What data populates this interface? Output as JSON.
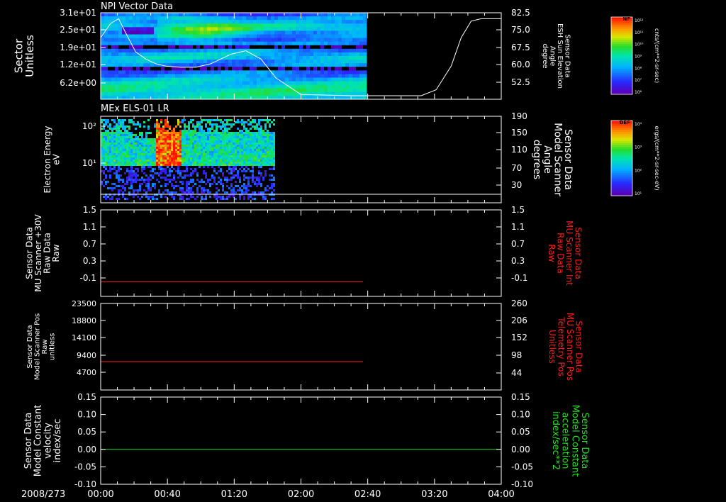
{
  "date_label": "2008/273",
  "time_ticks": [
    "00:00",
    "00:40",
    "01:20",
    "02:00",
    "02:40",
    "03:20",
    "04:00"
  ],
  "colors": {
    "axis": "#ffffff",
    "red_trace": "#ff2020",
    "green_trace": "#20e020",
    "red_label": "#ff1a1a",
    "green_label": "#22dd22",
    "background": "#000000"
  },
  "colorbars": [
    {
      "name": "NF",
      "units": "cnts/(cm**2-sr-sec)",
      "ticks": [
        "10¹²",
        "10¹¹",
        "10¹⁰",
        "10⁹",
        "10⁸",
        "10⁷",
        "10⁶"
      ]
    },
    {
      "name": "DEF",
      "units": "ergs/(cm**2-sr-sec-eV)",
      "ticks": [
        "10⁴",
        "10³",
        "10²",
        "10¹"
      ]
    }
  ],
  "chart_data": [
    {
      "type": "heatmap",
      "title": "NPI Vector Data",
      "ylabel": [
        "Sector",
        "Unitless"
      ],
      "yticks": [
        "3.1e+01",
        "2.5e+01",
        "1.9e+01",
        "1.2e+01",
        "6.2e+00"
      ],
      "y2label": [
        "Sensor Data",
        "ESH Sun Elevation",
        "Angle",
        "degree"
      ],
      "y2ticks": [
        "82.5",
        "75.0",
        "67.5",
        "60.0",
        "52.5"
      ],
      "y2lim": [
        46,
        82.5
      ],
      "data_end_hours": 2.62,
      "overlay_line": {
        "name": "ESH Sun Elevation Angle",
        "x": [
          0,
          0.1,
          0.18,
          0.25,
          0.35,
          0.45,
          0.55,
          0.65,
          0.8,
          0.95,
          1.1,
          1.2,
          1.3,
          1.45,
          1.6,
          1.75,
          2.0,
          2.5,
          3.0,
          3.2,
          3.35,
          3.5,
          3.6,
          3.7,
          3.8,
          4.0
        ],
        "y": [
          72,
          78,
          80,
          74,
          66,
          63,
          61,
          60,
          59.5,
          59.5,
          61,
          63,
          65,
          66.5,
          63,
          55,
          48,
          47.5,
          47.5,
          47.5,
          50,
          60,
          72,
          79,
          80,
          80
        ]
      }
    },
    {
      "type": "heatmap",
      "title": "MEx ELS-01 LR",
      "ylabel": [
        "Electron Energy",
        "eV"
      ],
      "yticks": [
        "10²",
        "10¹"
      ],
      "y2label": [
        "Sensor Data",
        "Model Scanner",
        "Angle",
        "degrees"
      ],
      "y2ticks": [
        "190",
        "150",
        "110",
        "70",
        "30"
      ],
      "data_end_hours": 1.73,
      "overlay_line": {
        "name": "Model Scanner Angle",
        "x": [
          0,
          4
        ],
        "y": [
          10,
          10
        ]
      }
    },
    {
      "type": "line",
      "ylabel": [
        "Sensor Data",
        "MU Scanner +30V",
        "Raw Data",
        "Raw"
      ],
      "yticks": [
        "1.5",
        "1.1",
        "0.7",
        "0.3",
        "-0.1"
      ],
      "ylim": [
        -0.3,
        1.5
      ],
      "y2label": [
        "Sensor Data",
        "MU Scanner Int",
        "Raw Data",
        "Raw"
      ],
      "y2ticks": [
        "1.5",
        "1.1",
        "0.7",
        "0.3",
        "-0.1"
      ],
      "series": [
        {
          "values_x": [
            0,
            2.62
          ],
          "values_y": [
            0,
            0
          ]
        }
      ]
    },
    {
      "type": "line",
      "ylabel": [
        "Sensor Data",
        "Model Scanner Pos",
        "Raw",
        "unitless"
      ],
      "yticks": [
        "23500",
        "18800",
        "14100",
        "9400",
        "4700"
      ],
      "ylim": [
        0,
        23500
      ],
      "y2label": [
        "Sensor Data",
        "MU Scanner Pos",
        "Telemetry Pos",
        "Unitless"
      ],
      "y2ticks": [
        "260",
        "206",
        "152",
        "98",
        "44"
      ],
      "series": [
        {
          "values_x": [
            0,
            2.62
          ],
          "values_y": [
            7700,
            7700
          ]
        }
      ]
    },
    {
      "type": "line",
      "ylabel": [
        "Sensor Data",
        "Model Constant",
        "velocity",
        "index/sec"
      ],
      "yticks": [
        "0.15",
        "0.10",
        "0.05",
        "0.00",
        "-0.05",
        "-0.10"
      ],
      "ylim": [
        -0.1,
        0.15
      ],
      "y2label": [
        "Sensor Data",
        "Model Constant",
        "acceleration",
        "index/sec**2"
      ],
      "y2ticks": [
        "0.15",
        "0.10",
        "0.05",
        "0.00",
        "-0.05",
        "-0.10"
      ],
      "series": [
        {
          "values_x": [
            0,
            4
          ],
          "values_y": [
            0,
            0
          ]
        }
      ]
    }
  ]
}
